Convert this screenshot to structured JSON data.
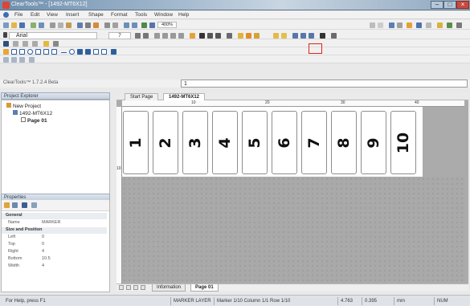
{
  "window": {
    "title": "ClearTools™ - [1492-MT6X12]"
  },
  "menu": [
    "File",
    "Edit",
    "View",
    "Insert",
    "Shape",
    "Format",
    "Tools",
    "Window",
    "Help"
  ],
  "toolbar": {
    "font_name": "Arial",
    "font_size": "7",
    "zoom": "400%"
  },
  "address_bar": {
    "label": "ClearTools™ 1.7.2.4 Beta",
    "formula_value": "1"
  },
  "project_explorer": {
    "title": "Project Explorer",
    "items": [
      "New Project",
      "1492-MT6X12",
      "Page 01"
    ]
  },
  "properties": {
    "title": "Properties",
    "rows": [
      {
        "kind": "section",
        "key": "General",
        "value": ""
      },
      {
        "kind": "prop",
        "key": "Name",
        "value": "MARKER"
      },
      {
        "kind": "section",
        "key": "Size and Position",
        "value": ""
      },
      {
        "kind": "prop",
        "key": "Left",
        "value": "0"
      },
      {
        "kind": "prop",
        "key": "Top",
        "value": "0"
      },
      {
        "kind": "prop",
        "key": "Right",
        "value": "4"
      },
      {
        "kind": "prop",
        "key": "Bottom",
        "value": "10.5"
      },
      {
        "kind": "prop",
        "key": "Width",
        "value": "4"
      }
    ]
  },
  "doc_tabs": [
    {
      "label": "Start Page",
      "active": false
    },
    {
      "label": "1492-MT6X12",
      "active": true
    }
  ],
  "ruler_h_labels": [
    "10",
    "20",
    "30",
    "40"
  ],
  "ruler_v_labels": [
    "10"
  ],
  "markers": [
    "1",
    "2",
    "3",
    "4",
    "5",
    "6",
    "7",
    "8",
    "9",
    "10"
  ],
  "sheet_tabs": [
    {
      "label": "Information",
      "active": false
    },
    {
      "label": "Page 01",
      "active": true
    }
  ],
  "status": {
    "help": "For Help, press F1",
    "layer": "MARKER LAYER",
    "position": "Marker 1/10 Column 1/1 Row 1/10",
    "x": "4.763",
    "y": "0.395",
    "unit": "mm",
    "mode": "NUM"
  },
  "colors": {
    "highlight": "#e2231a",
    "titlebar": "#8ea6bf",
    "canvas": "#ababab"
  }
}
